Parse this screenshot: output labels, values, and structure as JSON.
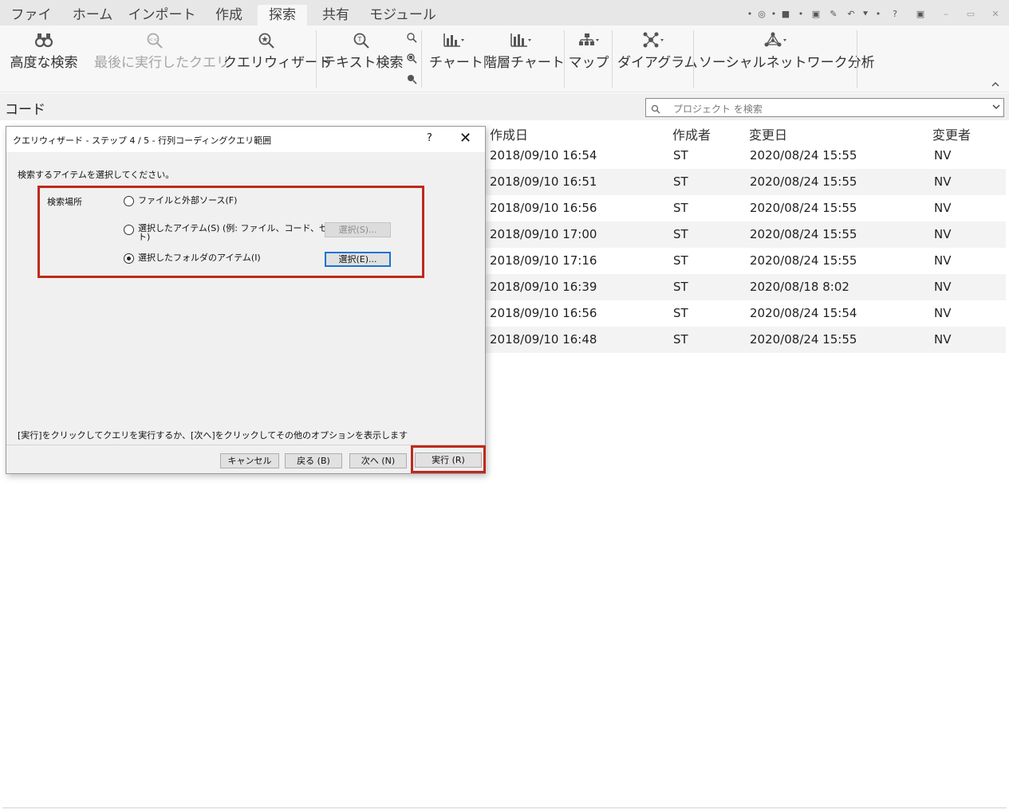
{
  "menu": {
    "tabs": [
      {
        "label": "ファイル"
      },
      {
        "label": "ホーム"
      },
      {
        "label": "インポート"
      },
      {
        "label": "作成"
      },
      {
        "label": "探索"
      },
      {
        "label": "共有"
      },
      {
        "label": "モジュール"
      }
    ],
    "active_tab": "探索",
    "quick_access": [
      "•",
      "◎",
      "•",
      "■",
      "•",
      "▣",
      "✎",
      "↶",
      "⯆",
      "•",
      "?",
      "▣",
      "–",
      "▭",
      "✕"
    ]
  },
  "ribbon": {
    "advanced_search": "高度な検索",
    "last_query": "最後に実行したクエリ",
    "query_wizard": "クエリウィザード",
    "text_search": "テキスト検索",
    "chart": "チャート",
    "hier_chart": "階層チャート",
    "map": "マップ",
    "diagram": "ダイアグラム",
    "sna": "ソーシャルネットワーク分析"
  },
  "code_panel": {
    "title": "コード",
    "search_placeholder": "プロジェクト を検索"
  },
  "table": {
    "headers": {
      "created": "作成日",
      "creator": "作成者",
      "modified": "変更日",
      "modifier": "変更者"
    },
    "rows": [
      {
        "created": "2018/09/10 16:54",
        "creator": "ST",
        "modified": "2020/08/24 15:55",
        "modifier": "NV"
      },
      {
        "created": "2018/09/10 16:51",
        "creator": "ST",
        "modified": "2020/08/24 15:55",
        "modifier": "NV"
      },
      {
        "created": "2018/09/10 16:56",
        "creator": "ST",
        "modified": "2020/08/24 15:55",
        "modifier": "NV"
      },
      {
        "created": "2018/09/10 17:00",
        "creator": "ST",
        "modified": "2020/08/24 15:55",
        "modifier": "NV"
      },
      {
        "created": "2018/09/10 17:16",
        "creator": "ST",
        "modified": "2020/08/24 15:55",
        "modifier": "NV"
      },
      {
        "created": "2018/09/10 16:39",
        "creator": "ST",
        "modified": "2020/08/18 8:02",
        "modifier": "NV"
      },
      {
        "created": "2018/09/10 16:56",
        "creator": "ST",
        "modified": "2020/08/24 15:54",
        "modifier": "NV"
      },
      {
        "created": "2018/09/10 16:48",
        "creator": "ST",
        "modified": "2020/08/24 15:55",
        "modifier": "NV"
      }
    ]
  },
  "dialog": {
    "title": "クエリウィザード - ステップ 4 / 5 - 行列コーディングクエリ範囲",
    "help": "?",
    "close": "✕",
    "instruction": "検索するアイテムを選択してください。",
    "group_label": "検索場所",
    "options": [
      {
        "label": "ファイルと外部ソース(F)",
        "selected": false
      },
      {
        "label_line1": "選択したアイテム(S) (例: ファイル、コード、セッ",
        "label_line2": "ト)",
        "selected": false
      },
      {
        "label": "選択したフォルダのアイテム(I)",
        "selected": true
      }
    ],
    "select_items_button": "選択(S)...",
    "select_folders_button": "選択(E)...",
    "footer_text": "[実行]をクリックしてクエリを実行するか、[次へ]をクリックしてその他のオプションを表示します",
    "buttons": {
      "cancel": "キャンセル",
      "back": "戻る (B)",
      "next": "次へ (N)",
      "run": "実行 (R)"
    }
  },
  "colors": {
    "highlight_red": "#c0291c",
    "focus_blue": "#1a72d6",
    "icon_gray": "#555555"
  }
}
